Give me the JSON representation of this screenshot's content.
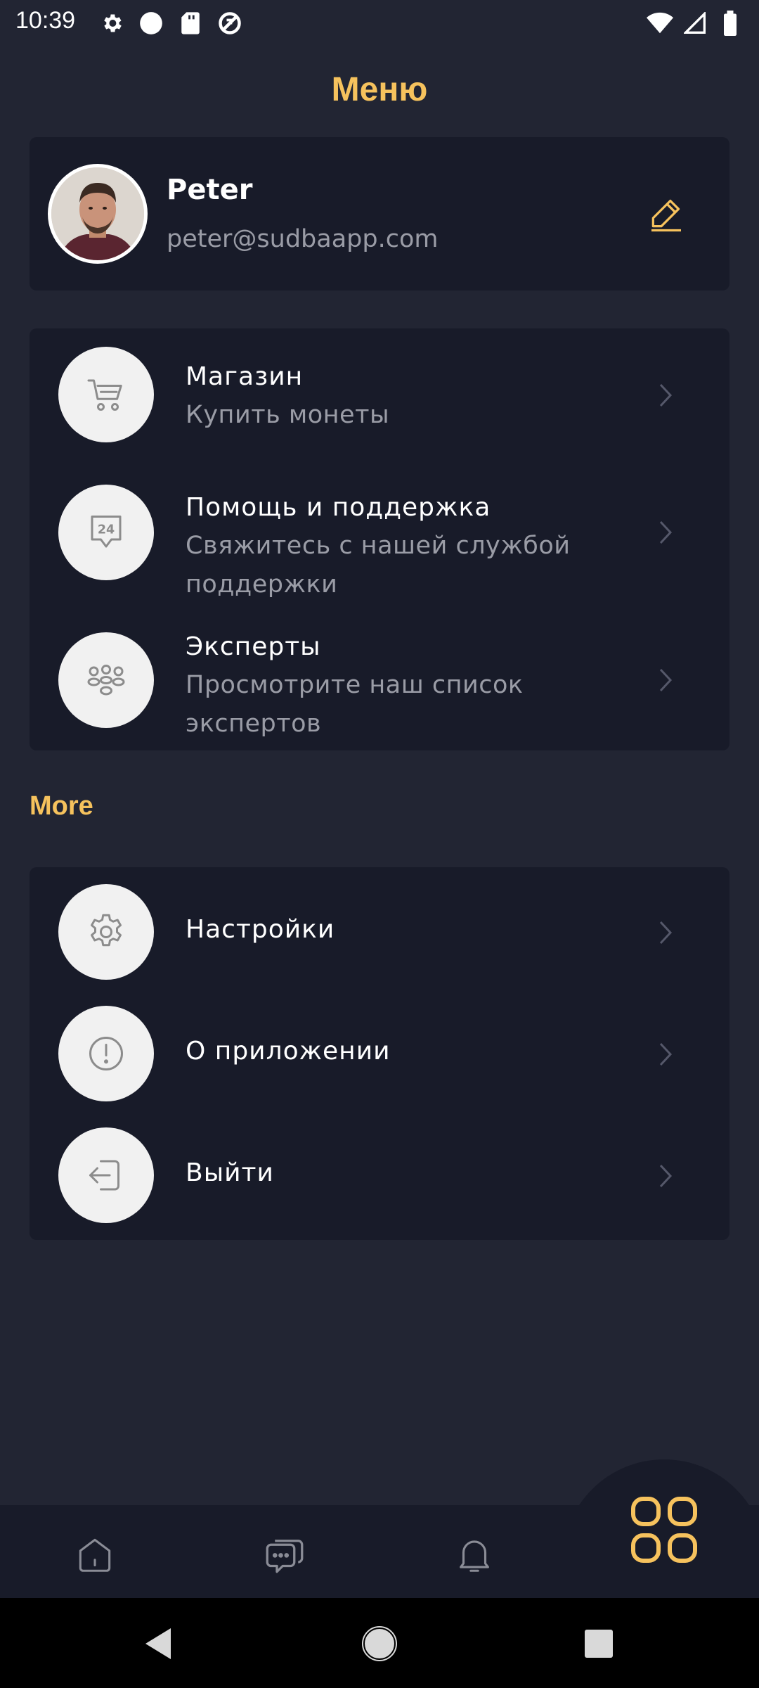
{
  "status_bar": {
    "time": "10:39",
    "left_icons": [
      "gear-icon",
      "circle-icon",
      "sd-card-icon",
      "do-not-disturb-icon"
    ],
    "right_icons": [
      "wifi-icon",
      "signal-icon",
      "battery-icon"
    ]
  },
  "header": {
    "title": "Меню"
  },
  "profile": {
    "name": "Peter",
    "email": "peter@sudbaapp.com",
    "edit_icon": "pencil-icon"
  },
  "menu_main": [
    {
      "title": "Магазин",
      "subtitle": "Купить монеты",
      "icon": "cart-icon"
    },
    {
      "title": "Помощь и поддержка",
      "subtitle": "Свяжитесь с нашей службой поддержки",
      "icon": "support-24-icon",
      "icon_text": "24"
    },
    {
      "title": "Эксперты",
      "subtitle": "Просмотрите наш список экспертов",
      "icon": "group-icon"
    }
  ],
  "section_more": {
    "label": "More"
  },
  "menu_more": [
    {
      "title": "Настройки",
      "icon": "gear-icon"
    },
    {
      "title": "О приложении",
      "icon": "info-alert-icon"
    },
    {
      "title": "Выйти",
      "icon": "logout-icon"
    }
  ],
  "bottom_nav": {
    "items": [
      "home-icon",
      "chat-icon",
      "bell-icon",
      "grid-menu-icon"
    ],
    "active": "grid-menu-icon"
  },
  "colors": {
    "background": "#222533",
    "card": "#181B29",
    "accent": "#F6C25D",
    "icon_circle": "#F1F1F1",
    "muted_text": "#9A9CA6"
  }
}
